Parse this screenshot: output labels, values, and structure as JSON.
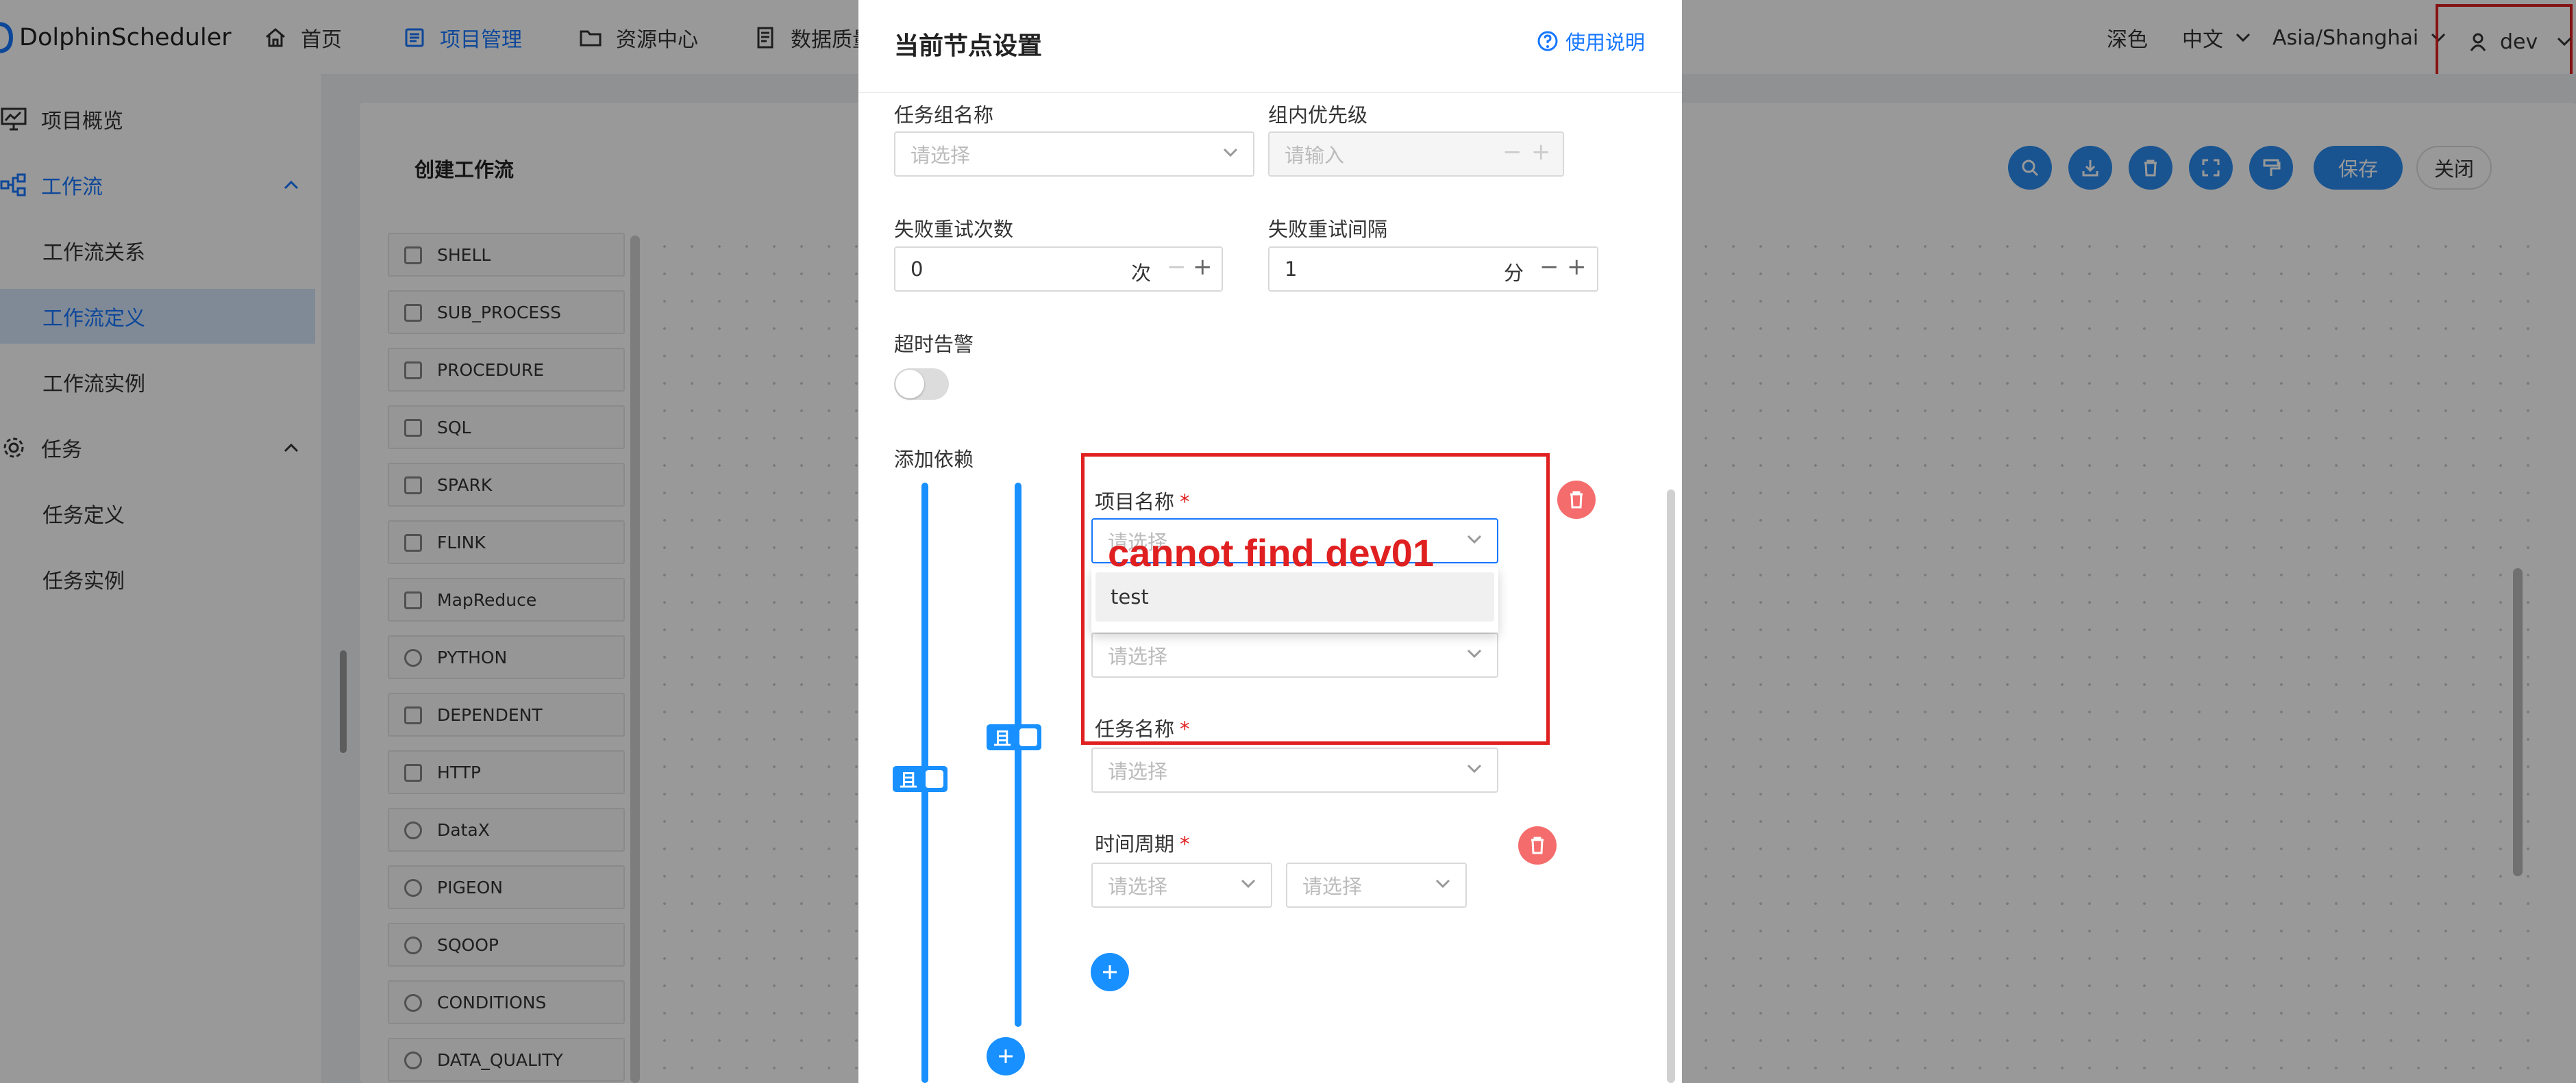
{
  "app": {
    "brand": "DolphinScheduler"
  },
  "topnav": [
    {
      "label": "首页",
      "icon": "home-icon"
    },
    {
      "label": "项目管理",
      "icon": "project-icon"
    },
    {
      "label": "资源中心",
      "icon": "folder-icon"
    },
    {
      "label": "数据质量",
      "icon": "document-icon"
    }
  ],
  "topright": {
    "theme": "深色",
    "language": "中文",
    "timezone": "Asia/Shanghai",
    "user": "dev"
  },
  "sidebar": {
    "items": [
      {
        "label": "项目概览"
      },
      {
        "label": "工作流"
      },
      {
        "label": "工作流关系"
      },
      {
        "label": "工作流定义"
      },
      {
        "label": "工作流实例"
      },
      {
        "label": "任务"
      },
      {
        "label": "任务定义"
      },
      {
        "label": "任务实例"
      }
    ]
  },
  "workflow": {
    "title": "创建工作流",
    "save_label": "保存",
    "close_label": "关闭"
  },
  "palette": [
    "SHELL",
    "SUB_PROCESS",
    "PROCEDURE",
    "SQL",
    "SPARK",
    "FLINK",
    "MapReduce",
    "PYTHON",
    "DEPENDENT",
    "HTTP",
    "DataX",
    "PIGEON",
    "SQOOP",
    "CONDITIONS",
    "DATA_QUALITY"
  ],
  "drawer": {
    "title": "当前节点设置",
    "help": "使用说明",
    "task_group_label": "任务组名称",
    "task_group_placeholder": "请选择",
    "priority_label": "组内优先级",
    "priority_placeholder": "请输入",
    "retry_times_label": "失败重试次数",
    "retry_times_value": "0",
    "retry_times_unit": "次",
    "retry_interval_label": "失败重试间隔",
    "retry_interval_value": "1",
    "retry_interval_unit": "分",
    "timeout_label": "超时告警",
    "dependency_label": "添加依赖",
    "and_label": "且",
    "project_label": "项目名称",
    "project_placeholder": "请选择",
    "dropdown_option": "test",
    "workflow_placeholder": "请选择",
    "task_label": "任务名称",
    "task_placeholder": "请选择",
    "cycle_label": "时间周期",
    "cycle_placeholder_1": "请选择",
    "cycle_placeholder_2": "请选择"
  },
  "annotation": {
    "text": "cannot find dev01",
    "color": "#e02020"
  },
  "colors": {
    "accent": "#1677ff",
    "danger": "#f56c6c",
    "annotation": "#e02020"
  }
}
